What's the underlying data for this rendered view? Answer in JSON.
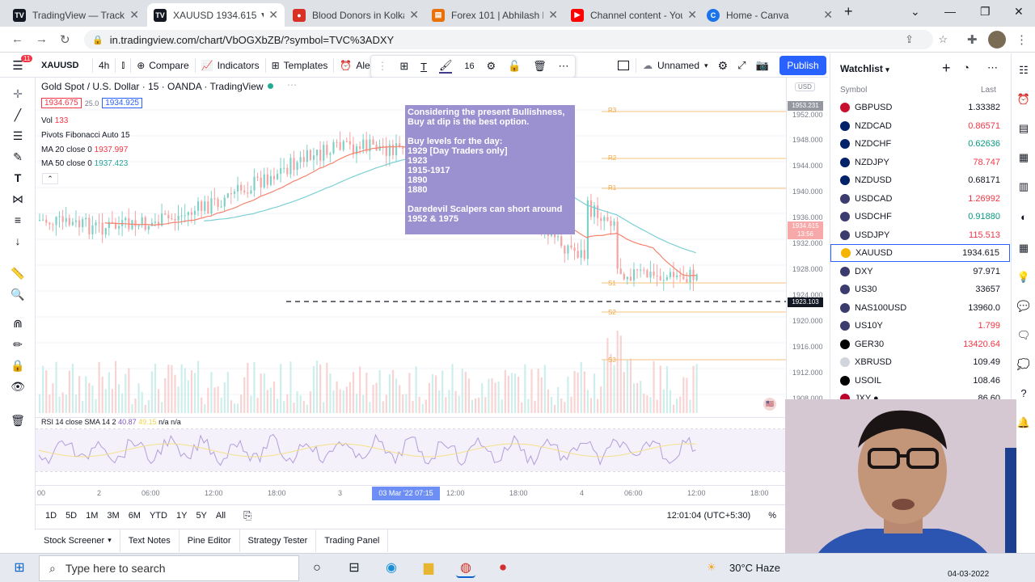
{
  "tabs": [
    {
      "label": "TradingView — Track A",
      "icon": "tradingview-icon",
      "color": "#131722",
      "active": false
    },
    {
      "label": "XAUUSD 1934.615 ▼",
      "icon": "tradingview-icon",
      "color": "#131722",
      "active": true
    },
    {
      "label": "Blood Donors in Kolka",
      "icon": "blood-drop-icon",
      "color": "#d93025",
      "active": false
    },
    {
      "label": "Forex 101 | Abhilash H",
      "icon": "page-icon",
      "color": "#e8710a",
      "active": false
    },
    {
      "label": "Channel content - You",
      "icon": "youtube-icon",
      "color": "#ff0000",
      "active": false
    },
    {
      "label": "Home - Canva",
      "icon": "canva-icon",
      "color": "#1a73e8",
      "active": false
    }
  ],
  "url": "in.tradingview.com/chart/VbOGXbZB/?symbol=TVC%3ADXY",
  "toolbar": {
    "notif_badge": "11",
    "symbol": "XAUUSD",
    "interval": "4h",
    "compare": "Compare",
    "indicators": "Indicators",
    "templates": "Templates",
    "alert": "Ale",
    "font_size": "16",
    "layout_name": "Unnamed",
    "publish": "Publish"
  },
  "legend": {
    "title": "Gold Spot / U.S. Dollar · 15 · OANDA · TradingView",
    "bid": "1934.675",
    "spread": "25.0",
    "ask": "1934.925",
    "vol_label": "Vol",
    "vol_value": "133",
    "pivots": "Pivots Fibonacci Auto 15",
    "ma20_label": "MA 20 close 0",
    "ma20_value": "1937.997",
    "ma50_label": "MA 50 close 0",
    "ma50_value": "1937.423",
    "rsi_label": "RSI 14 close SMA 14 2",
    "rsi_value1": "40.87",
    "rsi_value2": "49.15",
    "rsi_na": "n/a n/a"
  },
  "annotation": {
    "line1": "Considering the present Bullishness,",
    "line2": "Buy at dip is the best option.",
    "line3": "Buy levels for the day:",
    "line4": "1929 [Day Traders only]",
    "line5": "1923",
    "line6": "1915-1917",
    "line7": "1890",
    "line8": "1880",
    "line9": "Daredevil Scalpers can short around",
    "line10": "1952 & 1975"
  },
  "price_axis": {
    "currency": "USD",
    "labels": [
      "1952.000",
      "1948.000",
      "1944.000",
      "1940.000",
      "1936.000",
      "1932.000",
      "1928.000",
      "1924.000",
      "1920.000",
      "1916.000",
      "1912.000",
      "1908.000"
    ],
    "tag_top": "1953.231",
    "tag_current": "1934.615",
    "tag_countdown": "13:56",
    "tag_line": "1923.103"
  },
  "pivot_labels": [
    "R3",
    "R2",
    "R1",
    "S1",
    "S2",
    "S3"
  ],
  "time_axis": {
    "labels": [
      "00",
      "2",
      "06:00",
      "12:00",
      "18:00",
      "3",
      "12:00",
      "18:00",
      "4",
      "06:00",
      "12:00",
      "18:00"
    ],
    "highlight": "03 Mar '22   07:15"
  },
  "ranges": [
    "1D",
    "5D",
    "1M",
    "3M",
    "6M",
    "YTD",
    "1Y",
    "5Y",
    "All"
  ],
  "clock": "12:01:04 (UTC+5:30)",
  "percent": "%",
  "bottom_tabs": [
    "Stock Screener",
    "Text Notes",
    "Pine Editor",
    "Strategy Tester",
    "Trading Panel"
  ],
  "watchlist": {
    "title": "Watchlist",
    "col_symbol": "Symbol",
    "col_last": "Last",
    "rows": [
      {
        "symbol": "GBPUSD",
        "last": "1.33382",
        "color": "#131722",
        "flag": "#c8102e"
      },
      {
        "symbol": "NZDCAD",
        "last": "0.86571",
        "color": "#f23645",
        "flag": "#012169"
      },
      {
        "symbol": "NZDCHF",
        "last": "0.62636",
        "color": "#089981",
        "flag": "#012169"
      },
      {
        "symbol": "NZDJPY",
        "last": "78.747",
        "color": "#f23645",
        "flag": "#012169"
      },
      {
        "symbol": "NZDUSD",
        "last": "0.68171",
        "color": "#131722",
        "flag": "#012169"
      },
      {
        "symbol": "USDCAD",
        "last": "1.26992",
        "color": "#f23645",
        "flag": "#3c3b6e"
      },
      {
        "symbol": "USDCHF",
        "last": "0.91880",
        "color": "#089981",
        "flag": "#3c3b6e"
      },
      {
        "symbol": "USDJPY",
        "last": "115.513",
        "color": "#f23645",
        "flag": "#3c3b6e"
      },
      {
        "symbol": "XAUUSD",
        "last": "1934.615",
        "color": "#131722",
        "flag": "#f5b400",
        "selected": true
      },
      {
        "symbol": "DXY",
        "last": "97.971",
        "color": "#131722",
        "flag": "#3c3b6e"
      },
      {
        "symbol": "US30",
        "last": "33657",
        "color": "#131722",
        "flag": "#3c3b6e"
      },
      {
        "symbol": "NAS100USD",
        "last": "13960.0",
        "color": "#131722",
        "flag": "#3c3b6e"
      },
      {
        "symbol": "US10Y",
        "last": "1.799",
        "color": "#f23645",
        "flag": "#3c3b6e"
      },
      {
        "symbol": "GER30",
        "last": "13420.64",
        "color": "#f23645",
        "flag": "#000000"
      },
      {
        "symbol": "XBRUSD",
        "last": "109.49",
        "color": "#131722",
        "flag": "#d1d4dc"
      },
      {
        "symbol": "USOIL",
        "last": "108.46",
        "color": "#131722",
        "flag": "#000000"
      },
      {
        "symbol": "JXY ●",
        "last": "86.60",
        "color": "#131722",
        "flag": "#bc002d"
      }
    ]
  },
  "taskbar": {
    "search_placeholder": "Type here to search",
    "weather": "30°C  Haze",
    "date": "04-03-2022"
  }
}
